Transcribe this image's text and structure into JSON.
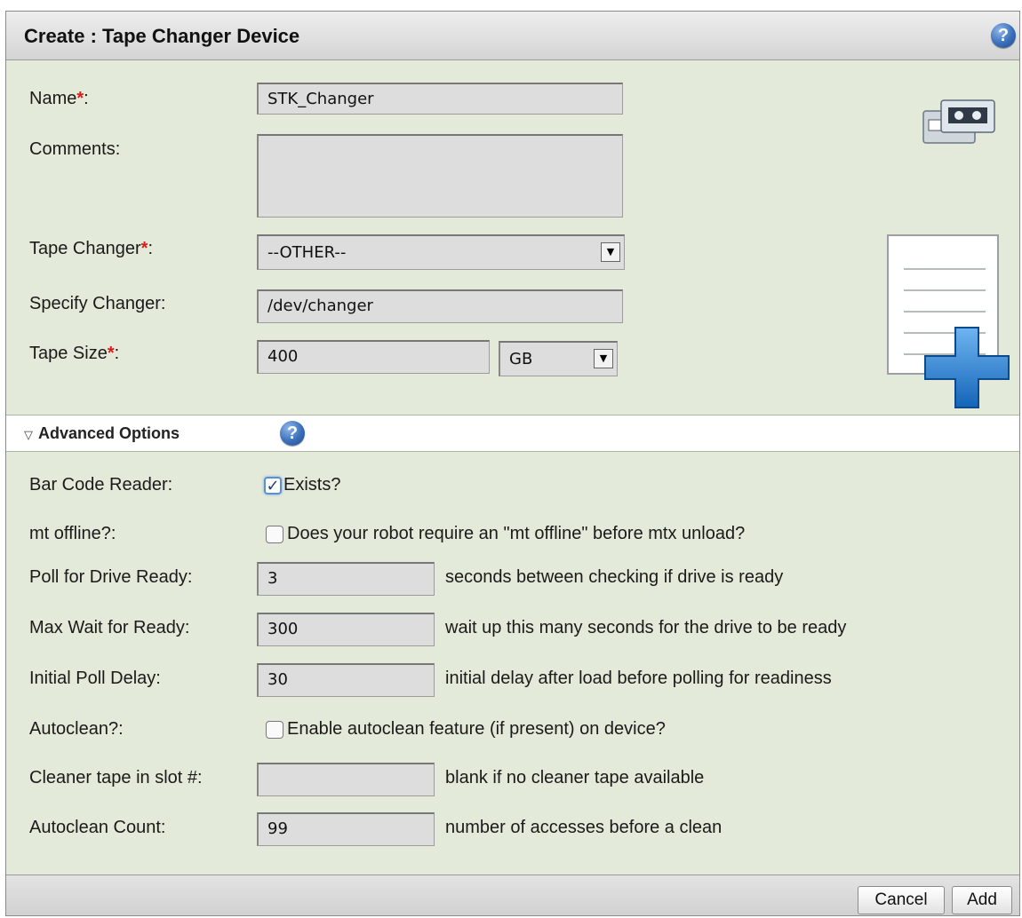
{
  "dialog": {
    "title": "Create : Tape Changer Device",
    "help_label": "?"
  },
  "form": {
    "name": {
      "label": "Name",
      "required_mark": "*",
      "suffix": ":",
      "value": "STK_Changer"
    },
    "comments": {
      "label": "Comments:",
      "value": ""
    },
    "tape_changer": {
      "label": "Tape Changer",
      "required_mark": "*",
      "suffix": ":",
      "value": "--OTHER--"
    },
    "specify_changer": {
      "label": "Specify Changer:",
      "value": "/dev/changer"
    },
    "tape_size": {
      "label": "Tape Size",
      "required_mark": "*",
      "suffix": ":",
      "value": "400",
      "unit": "GB"
    }
  },
  "advanced": {
    "toggle_glyph": "▽",
    "title": "Advanced Options",
    "help_label": "?",
    "bar_code_reader": {
      "label": "Bar Code Reader:",
      "checked": true,
      "check_glyph": "✓",
      "text": "Exists?"
    },
    "mt_offline": {
      "label": "mt offline?:",
      "checked": false,
      "text": "Does your robot require an \"mt offline\" before mtx unload?"
    },
    "poll_drive_ready": {
      "label": "Poll for Drive Ready:",
      "value": "3",
      "hint": "seconds between checking if drive is ready"
    },
    "max_wait_ready": {
      "label": "Max Wait for Ready:",
      "value": "300",
      "hint": "wait up this many seconds for the drive to be ready"
    },
    "initial_poll_delay": {
      "label": "Initial Poll Delay:",
      "value": "30",
      "hint": "initial delay after load before polling for readiness"
    },
    "autoclean": {
      "label": "Autoclean?:",
      "checked": false,
      "text": "Enable autoclean feature (if present) on device?"
    },
    "cleaner_slot": {
      "label": "Cleaner tape in slot #:",
      "value": "",
      "hint": "blank if no cleaner tape available"
    },
    "autoclean_count": {
      "label": "Autoclean Count:",
      "value": "99",
      "hint": "number of accesses before a clean"
    }
  },
  "footer": {
    "cancel_label": "Cancel",
    "add_label": "Add"
  },
  "icons": {
    "tape_device": "tape-cassette-icon",
    "new_document": "new-document-plus-icon",
    "help": "help-icon",
    "dropdown": "chevron-down-icon"
  },
  "colors": {
    "panel_background": "#e4ead9",
    "required": "#e01818",
    "help_blue": "#3b6fb8",
    "plus_blue": "#1f78c8"
  }
}
